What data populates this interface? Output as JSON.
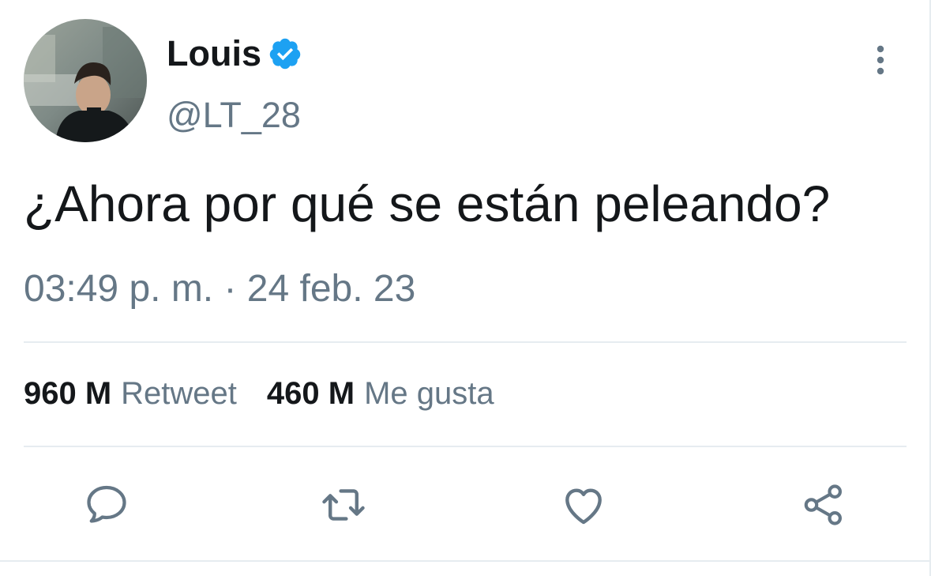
{
  "tweet": {
    "author": {
      "display_name": "Louis",
      "handle": "@LT_28",
      "verified": true,
      "verified_icon": "verified-badge-icon",
      "avatar": "profile-photo"
    },
    "menu_icon": "more-vertical-icon",
    "text": "¿Ahora por qué se están peleando?",
    "timestamp": "03:49 p. m. · 24 feb. 23",
    "stats": {
      "retweets_count": "960 M",
      "retweets_label": "Retweet",
      "likes_count": "460 M",
      "likes_label": "Me gusta"
    },
    "actions": [
      {
        "name": "reply",
        "icon": "reply-bubble-icon"
      },
      {
        "name": "retweet",
        "icon": "retweet-arrows-icon"
      },
      {
        "name": "like",
        "icon": "heart-icon"
      },
      {
        "name": "share",
        "icon": "share-nodes-icon"
      }
    ]
  },
  "colors": {
    "text_primary": "#14171a",
    "text_secondary": "#657786",
    "verified_blue": "#1da1f2",
    "divider": "#e6ecf0",
    "icon_gray": "#657786"
  }
}
